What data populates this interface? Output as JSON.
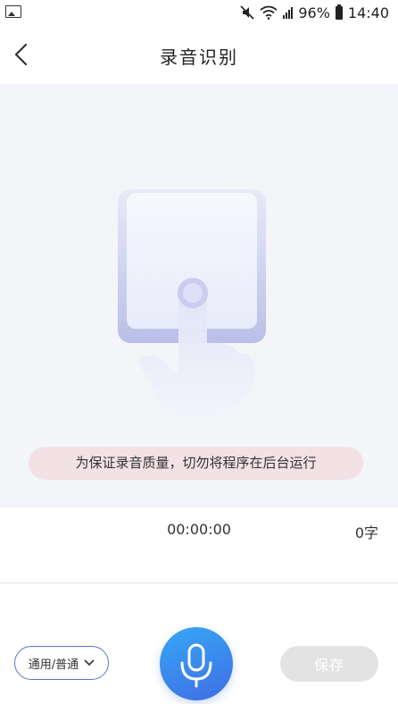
{
  "status_bar": {
    "battery_percent": "96%",
    "time": "14:40",
    "icons": [
      "image-icon",
      "mute-icon",
      "wifi-icon",
      "signal-icon",
      "battery-icon"
    ]
  },
  "header": {
    "title": "录音识别",
    "back_icon": "back-arrow-icon"
  },
  "illustration": {
    "icon": "tap-hand-illustration"
  },
  "tip": {
    "text": "为保证录音质量，切勿将程序在后台运行"
  },
  "counter": {
    "time": "00:00:00",
    "word_count": "0字"
  },
  "footer": {
    "language_label": "通用/普通",
    "mic_icon": "microphone-icon",
    "save_label": "保存"
  },
  "colors": {
    "accent": "#4a7be8",
    "stage_bg": "#f4f5f9",
    "tip_bg": "#f2e1e5",
    "save_disabled_bg": "#e3e3e3"
  }
}
